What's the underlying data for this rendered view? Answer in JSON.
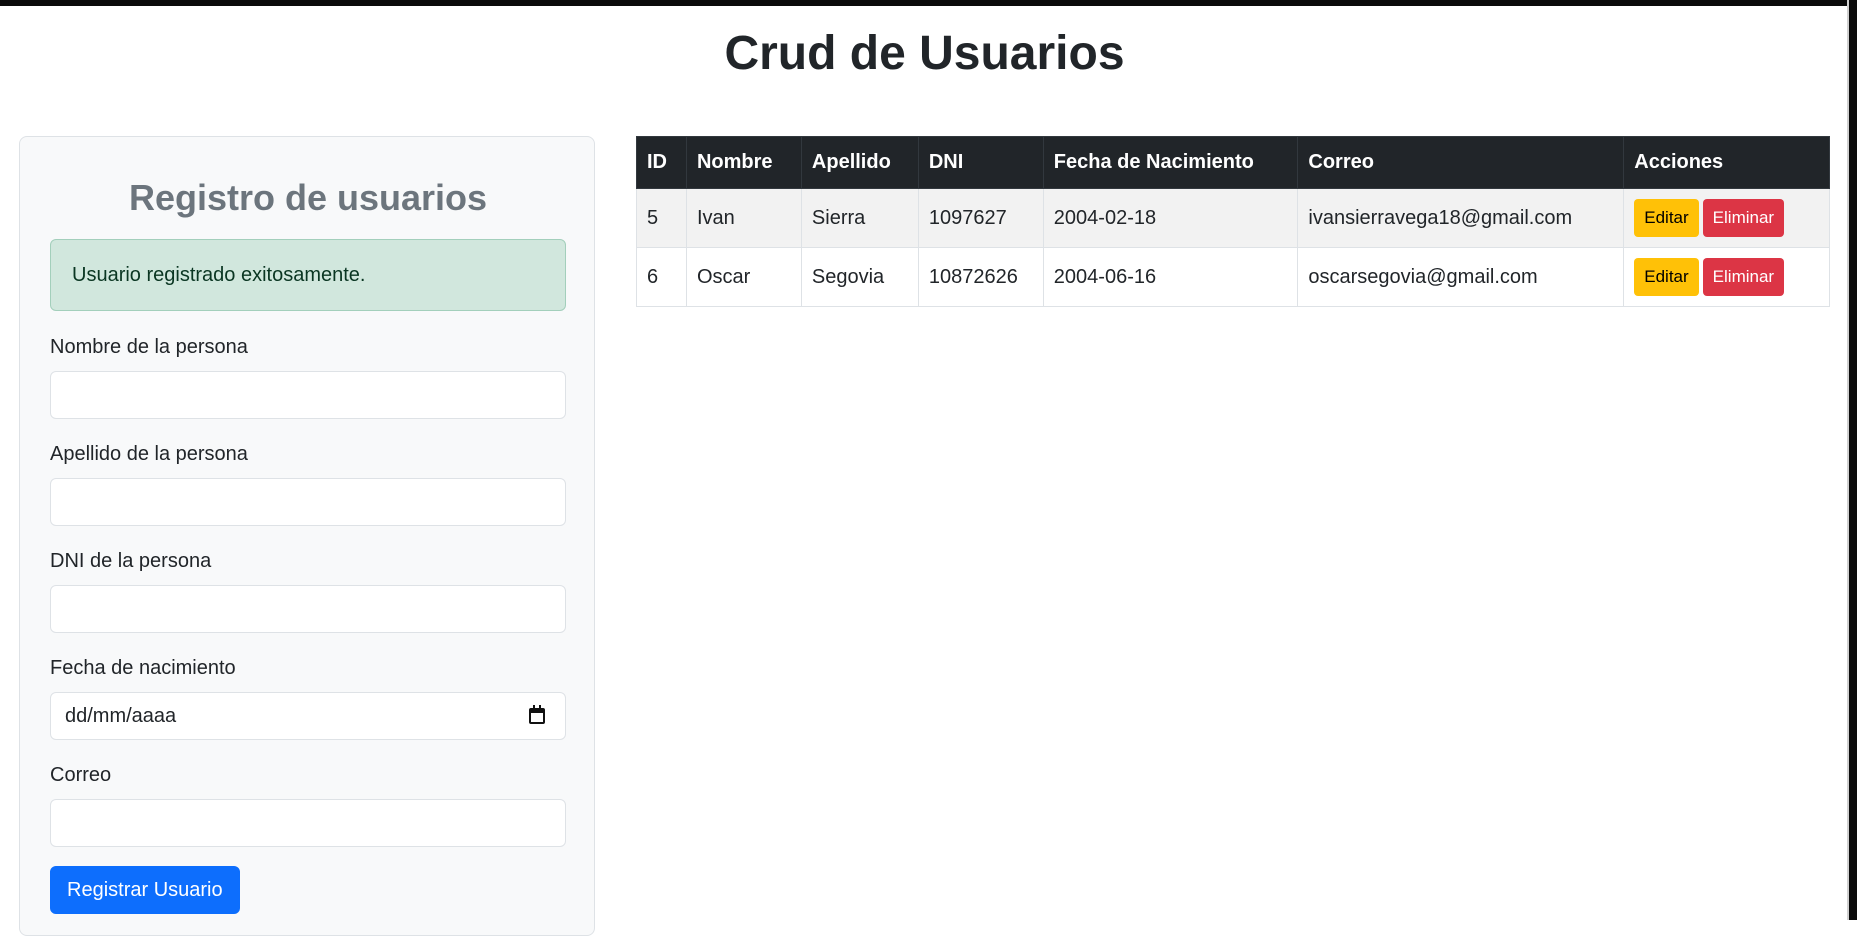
{
  "page": {
    "title": "Crud de Usuarios"
  },
  "form": {
    "title": "Registro de usuarios",
    "alert": "Usuario registrado exitosamente.",
    "fields": [
      {
        "label": "Nombre de la persona",
        "value": ""
      },
      {
        "label": "Apellido de la persona",
        "value": ""
      },
      {
        "label": "DNI de la persona",
        "value": ""
      },
      {
        "label": "Fecha de nacimiento",
        "value": "dd/mm/aaaa"
      },
      {
        "label": "Correo",
        "value": ""
      }
    ],
    "submit_label": "Registrar Usuario"
  },
  "table": {
    "headers": [
      "ID",
      "Nombre",
      "Apellido",
      "DNI",
      "Fecha de Nacimiento",
      "Correo",
      "Acciones"
    ],
    "rows": [
      {
        "id": "5",
        "nombre": "Ivan",
        "apellido": "Sierra",
        "dni": "1097627",
        "fecha": "2004-02-18",
        "correo": "ivansierravega18@gmail.com",
        "edit_label": "Editar",
        "delete_label": "Eliminar"
      },
      {
        "id": "6",
        "nombre": "Oscar",
        "apellido": "Segovia",
        "dni": "10872626",
        "fecha": "2004-06-16",
        "correo": "oscarsegovia@gmail.com",
        "edit_label": "Editar",
        "delete_label": "Eliminar"
      }
    ]
  },
  "colors": {
    "primary": "#0d6efd",
    "warning": "#ffc107",
    "danger": "#dc3545",
    "success_bg": "#d1e7dd",
    "table_header": "#212529"
  }
}
